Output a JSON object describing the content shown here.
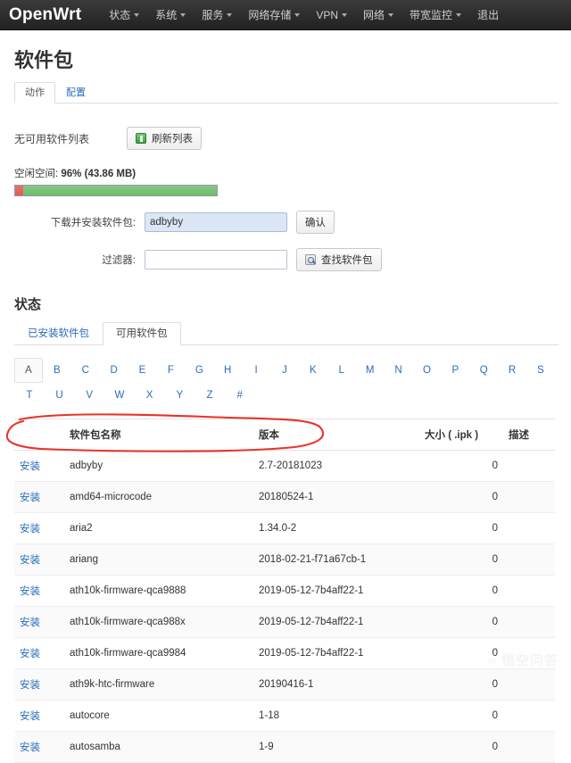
{
  "navbar": {
    "brand": "OpenWrt",
    "items": [
      {
        "label": "状态",
        "has_caret": true
      },
      {
        "label": "系统",
        "has_caret": true
      },
      {
        "label": "服务",
        "has_caret": true
      },
      {
        "label": "网络存储",
        "has_caret": true
      },
      {
        "label": "VPN",
        "has_caret": true
      },
      {
        "label": "网络",
        "has_caret": true
      },
      {
        "label": "带宽监控",
        "has_caret": true
      },
      {
        "label": "退出",
        "has_caret": false
      }
    ]
  },
  "page": {
    "title": "软件包",
    "tabs": [
      {
        "label": "动作",
        "active": true
      },
      {
        "label": "配置",
        "active": false
      }
    ]
  },
  "actions": {
    "no_list_note": "无可用软件列表",
    "refresh_button": "刷新列表",
    "refresh_icon": "refresh-green-icon"
  },
  "free_space": {
    "label_prefix": "空闲空间: ",
    "percent_text": "96%",
    "size_text": " (43.86 MB)",
    "free_percent": 96,
    "used_percent": 4,
    "used_color": "#e05b5b",
    "free_color": "#6cbb6c"
  },
  "install_form": {
    "label": "下载并安装软件包:",
    "value": "adbyby",
    "placeholder": "",
    "submit_label": "确认"
  },
  "filter_form": {
    "label": "过滤器:",
    "value": "",
    "placeholder": "",
    "submit_label": "查找软件包",
    "submit_icon": "search-icon"
  },
  "status": {
    "title": "状态",
    "tabs": [
      {
        "label": "已安装软件包",
        "active": false
      },
      {
        "label": "可用软件包",
        "active": true
      }
    ]
  },
  "alphabet": {
    "row1": [
      "A",
      "B",
      "C",
      "D",
      "E",
      "F",
      "G",
      "H",
      "I",
      "J",
      "K",
      "L",
      "M",
      "N",
      "O",
      "P",
      "Q",
      "R",
      "S"
    ],
    "row2": [
      "T",
      "U",
      "V",
      "W",
      "X",
      "Y",
      "Z",
      "#"
    ],
    "active": "A"
  },
  "table": {
    "headers": {
      "action": "",
      "name": "软件包名称",
      "version": "版本",
      "size": "大小 ( .ipk )",
      "description": "描述"
    },
    "install_label": "安装",
    "rows": [
      {
        "name": "adbyby",
        "version": "2.7-20181023",
        "size": "0",
        "description": ""
      },
      {
        "name": "amd64-microcode",
        "version": "20180524-1",
        "size": "0",
        "description": ""
      },
      {
        "name": "aria2",
        "version": "1.34.0-2",
        "size": "0",
        "description": ""
      },
      {
        "name": "ariang",
        "version": "2018-02-21-f71a67cb-1",
        "size": "0",
        "description": ""
      },
      {
        "name": "ath10k-firmware-qca9888",
        "version": "2019-05-12-7b4aff22-1",
        "size": "0",
        "description": ""
      },
      {
        "name": "ath10k-firmware-qca988x",
        "version": "2019-05-12-7b4aff22-1",
        "size": "0",
        "description": ""
      },
      {
        "name": "ath10k-firmware-qca9984",
        "version": "2019-05-12-7b4aff22-1",
        "size": "0",
        "description": ""
      },
      {
        "name": "ath9k-htc-firmware",
        "version": "20190416-1",
        "size": "0",
        "description": ""
      },
      {
        "name": "autocore",
        "version": "1-18",
        "size": "0",
        "description": ""
      },
      {
        "name": "autosamba",
        "version": "1-9",
        "size": "0",
        "description": ""
      }
    ]
  },
  "annotation": {
    "type": "hand-drawn-ellipse",
    "color": "#e8342a",
    "target": "adbyby"
  },
  "watermark": {
    "text": "悟空问答",
    "logo": "∞"
  }
}
